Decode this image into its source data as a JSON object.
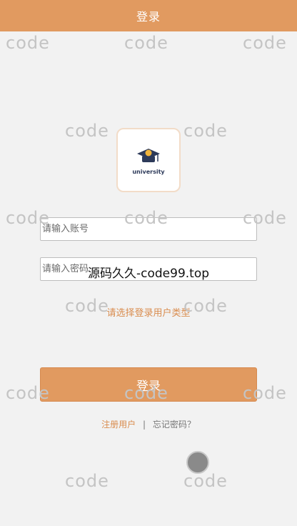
{
  "header": {
    "title": "登录"
  },
  "logo": {
    "text": "university",
    "icon": "graduation-cap-icon"
  },
  "form": {
    "account_placeholder": "请输入账号",
    "password_placeholder": "请输入密码",
    "overlay_watermark": "源码久久-code99.top",
    "user_type_label": "请选择登录用户类型",
    "login_label": "登录"
  },
  "links": {
    "register": "注册用户",
    "separator": "|",
    "forgot": "忘记密码？"
  },
  "watermark": {
    "text": "code"
  },
  "colors": {
    "accent": "#e19a60",
    "link": "#d98c4e",
    "background": "#f2f2f2"
  }
}
